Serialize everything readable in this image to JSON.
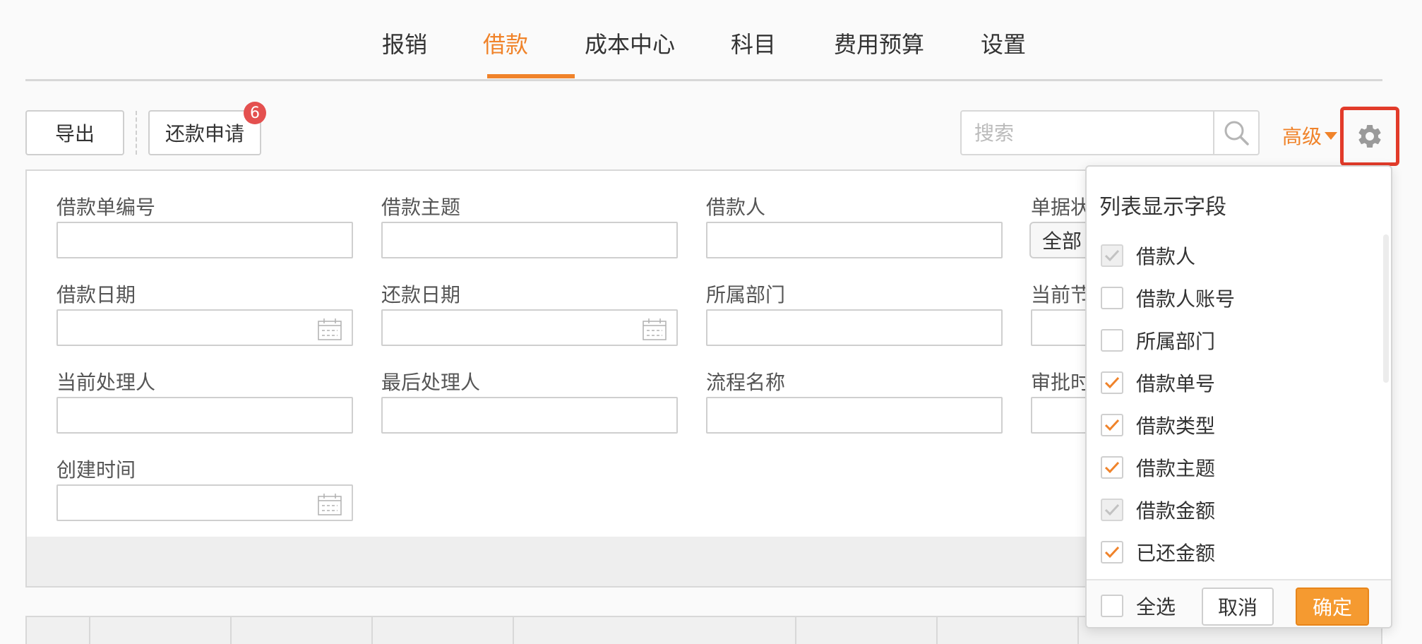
{
  "tabs": [
    {
      "label": "报销"
    },
    {
      "label": "借款"
    },
    {
      "label": "成本中心"
    },
    {
      "label": "科目"
    },
    {
      "label": "费用预算"
    },
    {
      "label": "设置"
    }
  ],
  "active_tab": "借款",
  "toolbar": {
    "export_label": "导出",
    "repay_label": "还款申请",
    "repay_badge": "6",
    "search_placeholder": "搜索",
    "advanced_label": "高级"
  },
  "filters": {
    "loan_no": "借款单编号",
    "loan_subject": "借款主题",
    "borrower": "借款人",
    "doc_status": "单据状",
    "doc_status_value": "全部",
    "loan_date": "借款日期",
    "repay_date": "还款日期",
    "department": "所属部门",
    "current_node": "当前节",
    "current_handler": "当前处理人",
    "last_handler": "最后处理人",
    "process_name": "流程名称",
    "approval_time": "审批时",
    "created_time": "创建时间"
  },
  "column_settings": {
    "title": "列表显示字段",
    "items": [
      {
        "label": "借款人",
        "state": "checked-disabled"
      },
      {
        "label": "借款人账号",
        "state": "unchecked"
      },
      {
        "label": "所属部门",
        "state": "unchecked"
      },
      {
        "label": "借款单号",
        "state": "checked"
      },
      {
        "label": "借款类型",
        "state": "checked"
      },
      {
        "label": "借款主题",
        "state": "checked"
      },
      {
        "label": "借款金额",
        "state": "checked-disabled"
      },
      {
        "label": "已还金额",
        "state": "checked"
      }
    ],
    "select_all_label": "全选",
    "cancel_label": "取消",
    "confirm_label": "确定"
  },
  "colors": {
    "accent": "#f0832a",
    "badge": "#e4504f",
    "highlight_border": "#e23b2a"
  }
}
